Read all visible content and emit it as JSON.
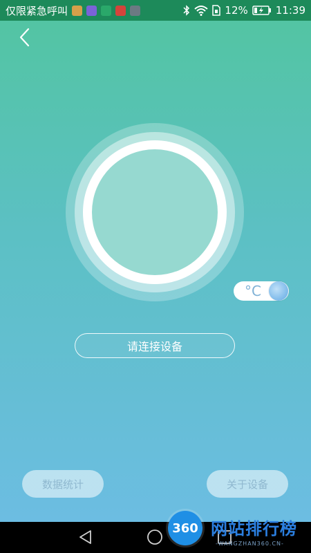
{
  "status_bar": {
    "carrier": "仅限紧急呼叫",
    "battery_percent": "12%",
    "time": "11:39",
    "notification_icons": [
      "weather-icon",
      "gallery-icon",
      "browser-icon",
      "music-icon",
      "camera-icon"
    ],
    "colors": [
      "#d6a04a",
      "#7a63d8",
      "#2aa86a",
      "#d4443b",
      "#6c7a83"
    ]
  },
  "main": {
    "unit_label": "°C",
    "connect_button_label": "请连接设备",
    "stats_button_label": "数据统计",
    "about_button_label": "关于设备"
  },
  "watermark": {
    "logo_text": "360",
    "title": "网站排行榜",
    "subtitle": "-WANGZHAN360.CN-"
  },
  "colors": {
    "status_bar_bg": "#1d8a5a",
    "gradient_top": "#52c5a0",
    "gradient_bottom": "#6cbde2"
  }
}
